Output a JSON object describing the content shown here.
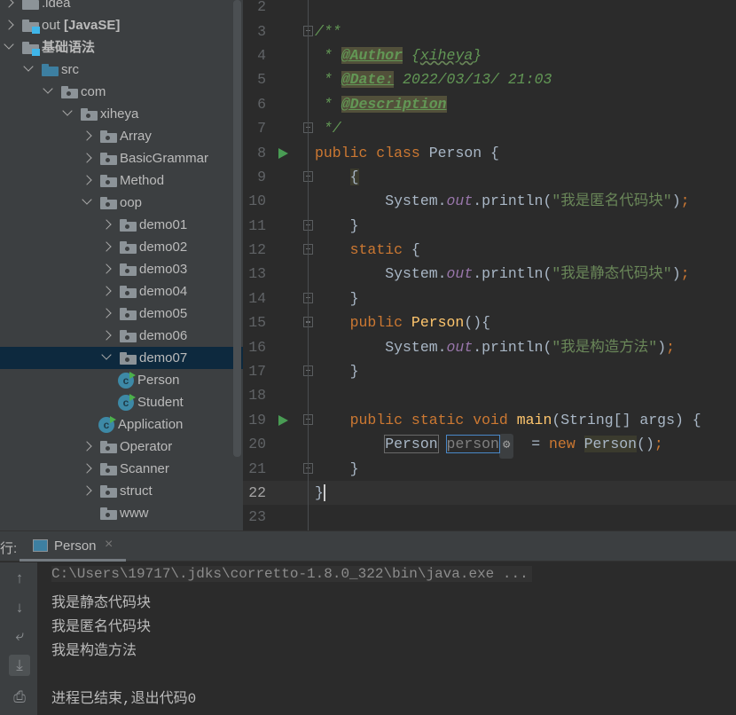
{
  "project_tree": [
    {
      "label": ".idea",
      "level": 0,
      "state": "closed",
      "icon": "folder-icon"
    },
    {
      "label": "out [JavaSE]",
      "level": 0,
      "state": "closed",
      "icon": "module-folder-icon",
      "bold_part": "[JavaSE]"
    },
    {
      "label": "基础语法",
      "level": 0,
      "state": "open",
      "icon": "module-folder-icon",
      "bold": true
    },
    {
      "label": "src",
      "level": 1,
      "state": "open",
      "icon": "source-folder-icon"
    },
    {
      "label": "com",
      "level": 2,
      "state": "open",
      "icon": "package-icon"
    },
    {
      "label": "xiheya",
      "level": 3,
      "state": "open",
      "icon": "package-icon"
    },
    {
      "label": "Array",
      "level": 4,
      "state": "closed",
      "icon": "package-icon"
    },
    {
      "label": "BasicGrammar",
      "level": 4,
      "state": "closed",
      "icon": "package-icon"
    },
    {
      "label": "Method",
      "level": 4,
      "state": "closed",
      "icon": "package-icon"
    },
    {
      "label": "oop",
      "level": 4,
      "state": "open",
      "icon": "package-icon"
    },
    {
      "label": "demo01",
      "level": 5,
      "state": "closed",
      "icon": "package-icon"
    },
    {
      "label": "demo02",
      "level": 5,
      "state": "closed",
      "icon": "package-icon"
    },
    {
      "label": "demo03",
      "level": 5,
      "state": "closed",
      "icon": "package-icon"
    },
    {
      "label": "demo04",
      "level": 5,
      "state": "closed",
      "icon": "package-icon"
    },
    {
      "label": "demo05",
      "level": 5,
      "state": "closed",
      "icon": "package-icon"
    },
    {
      "label": "demo06",
      "level": 5,
      "state": "closed",
      "icon": "package-icon"
    },
    {
      "label": "demo07",
      "level": 5,
      "state": "open",
      "icon": "package-icon",
      "selected": true
    },
    {
      "label": "Person",
      "level": 6,
      "state": "none",
      "icon": "java-class-runnable-icon"
    },
    {
      "label": "Student",
      "level": 6,
      "state": "none",
      "icon": "java-class-runnable-icon"
    },
    {
      "label": "Application",
      "level": 5,
      "state": "none",
      "icon": "java-class-runnable-icon"
    },
    {
      "label": "Operator",
      "level": 4,
      "state": "closed",
      "icon": "package-icon"
    },
    {
      "label": "Scanner",
      "level": 4,
      "state": "closed",
      "icon": "package-icon"
    },
    {
      "label": "struct",
      "level": 4,
      "state": "closed",
      "icon": "package-icon"
    },
    {
      "label": "www",
      "level": 4,
      "state": "none",
      "icon": "package-icon"
    }
  ],
  "editor": {
    "current_line": 22,
    "lines": [
      {
        "n": 2,
        "tokens": []
      },
      {
        "n": 3,
        "fold": true,
        "tokens": [
          [
            "/**",
            "d"
          ]
        ]
      },
      {
        "n": 4,
        "tokens": [
          [
            " * ",
            "d"
          ],
          [
            "@Author",
            "tag"
          ],
          [
            " {",
            "d"
          ],
          [
            "xiheya",
            "d wavy"
          ],
          [
            "}",
            "d"
          ]
        ]
      },
      {
        "n": 5,
        "tokens": [
          [
            " * ",
            "d"
          ],
          [
            "@Date:",
            "tag"
          ],
          [
            " 2022/03/13/ 21:03",
            "d"
          ]
        ]
      },
      {
        "n": 6,
        "tokens": [
          [
            " * ",
            "d"
          ],
          [
            "@Description",
            "tag"
          ]
        ]
      },
      {
        "n": 7,
        "fold": true,
        "tokens": [
          [
            " */",
            "d"
          ]
        ]
      },
      {
        "n": 8,
        "run": true,
        "tokens": [
          [
            "public class ",
            "k"
          ],
          [
            "Person {",
            ""
          ]
        ]
      },
      {
        "n": 9,
        "fold": true,
        "tokens": [
          [
            "    ",
            ""
          ],
          [
            "{",
            "hl"
          ]
        ]
      },
      {
        "n": 10,
        "tokens": [
          [
            "        System.",
            ""
          ],
          [
            "out",
            "f"
          ],
          [
            ".println(",
            ""
          ],
          [
            "\"我是匿名代码块\"",
            "s"
          ],
          [
            ")",
            ""
          ],
          [
            ";",
            "k"
          ]
        ]
      },
      {
        "n": 11,
        "fold": true,
        "tokens": [
          [
            "    }",
            ""
          ]
        ]
      },
      {
        "n": 12,
        "fold": true,
        "tokens": [
          [
            "    ",
            ""
          ],
          [
            "static ",
            "k"
          ],
          [
            "{",
            ""
          ]
        ]
      },
      {
        "n": 13,
        "tokens": [
          [
            "        System.",
            ""
          ],
          [
            "out",
            "f"
          ],
          [
            ".println(",
            ""
          ],
          [
            "\"我是静态代码块\"",
            "s"
          ],
          [
            ")",
            ""
          ],
          [
            ";",
            "k"
          ]
        ]
      },
      {
        "n": 14,
        "fold": true,
        "tokens": [
          [
            "    }",
            ""
          ]
        ]
      },
      {
        "n": 15,
        "fold": true,
        "tokens": [
          [
            "    ",
            ""
          ],
          [
            "public ",
            "k"
          ],
          [
            "Person",
            "m"
          ],
          [
            "(){",
            ""
          ]
        ]
      },
      {
        "n": 16,
        "tokens": [
          [
            "        System.",
            ""
          ],
          [
            "out",
            "f"
          ],
          [
            ".println(",
            ""
          ],
          [
            "\"我是构造方法\"",
            "s"
          ],
          [
            ")",
            ""
          ],
          [
            ";",
            "k"
          ]
        ]
      },
      {
        "n": 17,
        "fold": true,
        "tokens": [
          [
            "    }",
            ""
          ]
        ]
      },
      {
        "n": 18,
        "tokens": []
      },
      {
        "n": 19,
        "run": true,
        "fold": true,
        "tokens": [
          [
            "    ",
            ""
          ],
          [
            "public static void ",
            "k"
          ],
          [
            "main",
            "m"
          ],
          [
            "(String[] args) {",
            ""
          ]
        ]
      },
      {
        "n": 20,
        "tokens": [
          [
            "        ",
            ""
          ],
          [
            "Person",
            "box1"
          ],
          [
            " ",
            ""
          ],
          [
            "person",
            "box2"
          ],
          [
            "⚙",
            "gear"
          ],
          [
            "  = ",
            ""
          ],
          [
            "new ",
            "k"
          ],
          [
            "Person",
            "hl"
          ],
          [
            "()",
            ""
          ],
          [
            ";",
            "k"
          ]
        ]
      },
      {
        "n": 21,
        "fold": true,
        "tokens": [
          [
            "    }",
            ""
          ]
        ]
      },
      {
        "n": 22,
        "tokens": [
          [
            "}",
            "caret"
          ]
        ]
      },
      {
        "n": 23,
        "tokens": []
      }
    ]
  },
  "run_panel": {
    "label": "行:",
    "tab_label": "Person",
    "tab_close": "×",
    "toolbar": [
      {
        "icon": "up-arrow-icon",
        "glyph": "↑"
      },
      {
        "icon": "down-arrow-icon",
        "glyph": "↓"
      },
      {
        "icon": "soft-wrap-icon",
        "glyph": "⤶"
      },
      {
        "icon": "scroll-to-end-icon",
        "glyph": "⤓",
        "active": true
      },
      {
        "icon": "print-icon",
        "glyph": "⎙"
      }
    ],
    "output": [
      "C:\\Users\\19717\\.jdks\\corretto-1.8.0_322\\bin\\java.exe ...",
      "我是静态代码块",
      "我是匿名代码块",
      "我是构造方法",
      "",
      "进程已结束,退出代码0"
    ]
  }
}
